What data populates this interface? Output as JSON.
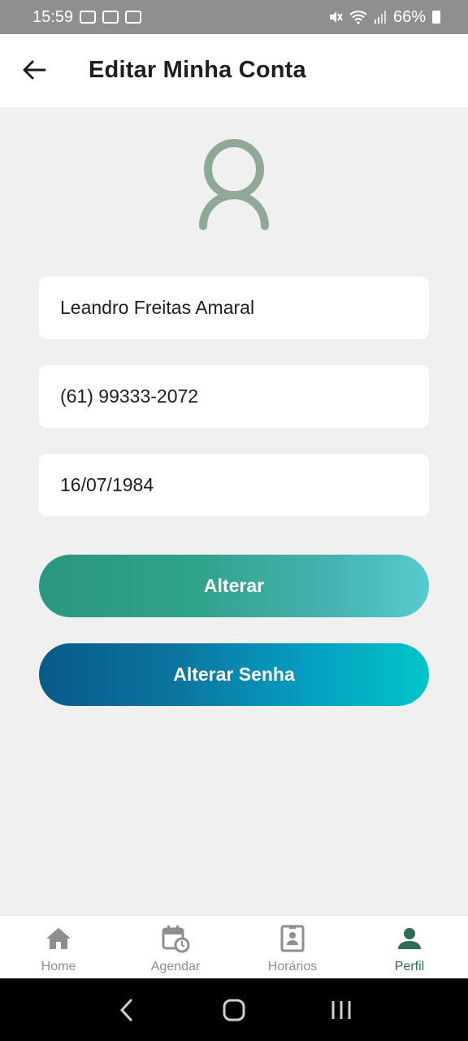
{
  "status_bar": {
    "time": "15:59",
    "battery": "66%"
  },
  "header": {
    "title": "Editar Minha Conta"
  },
  "form": {
    "name": "Leandro Freitas Amaral",
    "phone": "(61) 99333-2072",
    "birth_date": "16/07/1984"
  },
  "buttons": {
    "update_label": "Alterar",
    "change_password_label": "Alterar Senha"
  },
  "bottom_nav": {
    "items": [
      {
        "label": "Home",
        "icon": "home-icon"
      },
      {
        "label": "Agendar",
        "icon": "calendar-clock-icon"
      },
      {
        "label": "Horários",
        "icon": "schedule-card-icon"
      },
      {
        "label": "Perfil",
        "icon": "person-icon"
      }
    ],
    "active": "Perfil"
  },
  "colors": {
    "avatar": "#8fa898",
    "nav_active": "#2f6a5a",
    "nav_inactive": "#8e8e8e"
  }
}
